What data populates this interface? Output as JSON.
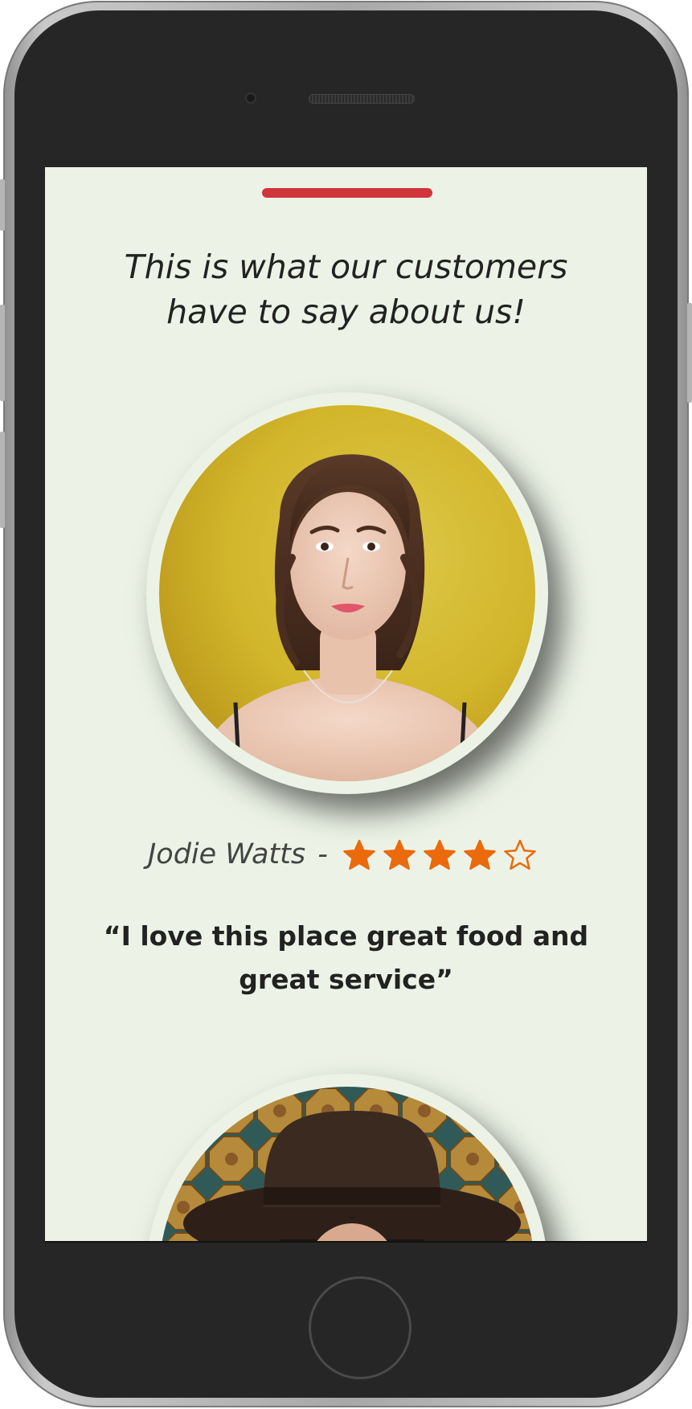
{
  "colors": {
    "accent_bar": "#d1343a",
    "screen_bg": "#ecf3e6",
    "star": "#ea6a0c"
  },
  "testimonials": {
    "heading_line1": "This is what our customers",
    "heading_line2": "have to say about us!",
    "items": [
      {
        "name": "Jodie Watts",
        "separator": "-",
        "rating": 4,
        "rating_max": 5,
        "quote": "“I love this place great food and great service”",
        "photo": "woman-portrait-yellow-background"
      },
      {
        "photo": "person-with-hat-portrait"
      }
    ]
  },
  "icons": {
    "star_filled": "star-filled-icon",
    "star_empty": "star-outline-icon"
  }
}
